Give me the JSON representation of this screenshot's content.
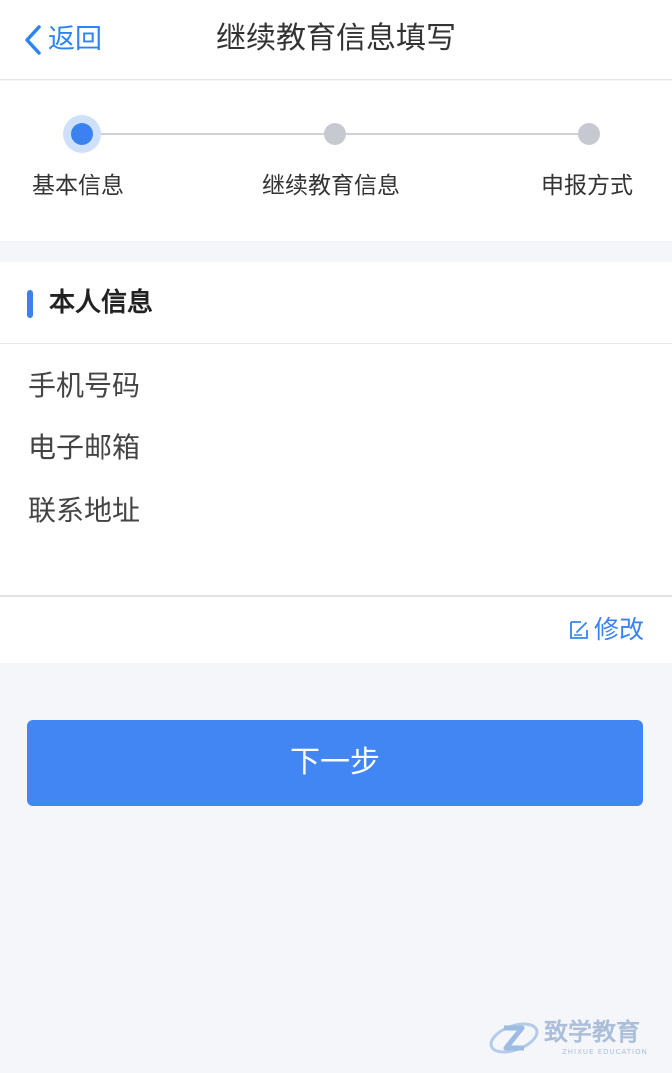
{
  "header": {
    "back_label": "返回",
    "title": "继续教育信息填写"
  },
  "steps": [
    {
      "label": "基本信息",
      "active": true
    },
    {
      "label": "继续教育信息",
      "active": false
    },
    {
      "label": "申报方式",
      "active": false
    }
  ],
  "personal_info": {
    "section_title": "本人信息",
    "fields": [
      "手机号码",
      "电子邮箱",
      "联系地址"
    ],
    "edit_label": "修改"
  },
  "next_button": {
    "label": "下一步"
  },
  "watermark": {
    "name": "致学教育",
    "subtitle": "ZHIXUE EDUCATION"
  },
  "colors": {
    "accent": "#3b82f0",
    "button": "#4286f4",
    "background": "#f4f6f9"
  }
}
